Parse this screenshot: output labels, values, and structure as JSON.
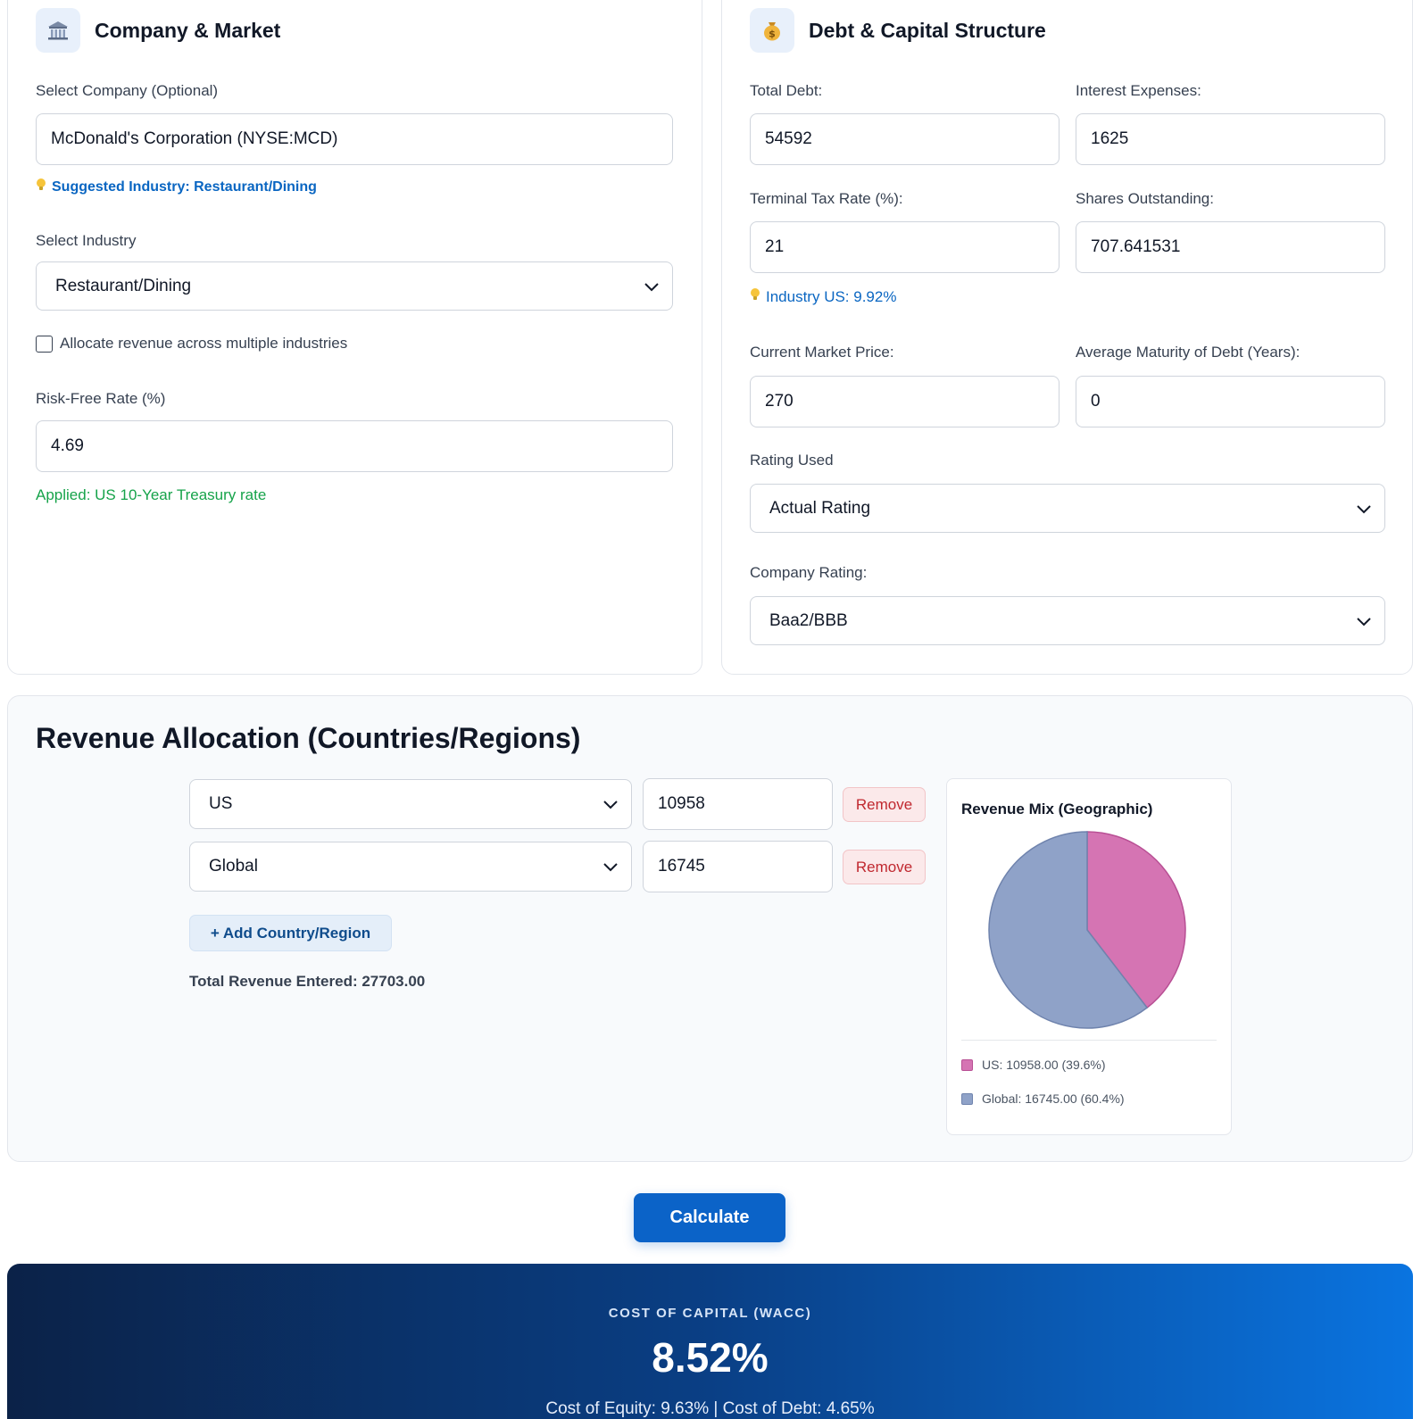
{
  "company_market": {
    "title": "Company & Market",
    "icon": "bank-building-icon",
    "company_label": "Select Company (Optional)",
    "company_value": "McDonald's Corporation (NYSE:MCD)",
    "suggested_industry": "Suggested Industry: Restaurant/Dining",
    "industry_label": "Select Industry",
    "industry_value": "Restaurant/Dining",
    "allocate_label": "Allocate revenue across multiple industries",
    "risk_free_label": "Risk-Free Rate (%)",
    "risk_free_value": "4.69",
    "applied_note": "Applied: US 10-Year Treasury rate"
  },
  "debt_capital": {
    "title": "Debt & Capital Structure",
    "icon": "money-bag-icon",
    "total_debt_label": "Total Debt:",
    "total_debt_value": "54592",
    "interest_label": "Interest Expenses:",
    "interest_value": "1625",
    "tax_label": "Terminal Tax Rate (%):",
    "tax_value": "21",
    "shares_label": "Shares Outstanding:",
    "shares_value": "707.641531",
    "industry_hint": "Industry US: 9.92%",
    "price_label": "Current Market Price:",
    "price_value": "270",
    "maturity_label": "Average Maturity of Debt (Years):",
    "maturity_value": "0",
    "rating_used_label": "Rating Used",
    "rating_used_value": "Actual Rating",
    "company_rating_label": "Company Rating:",
    "company_rating_value": "Baa2/BBB"
  },
  "revenue": {
    "title": "Revenue Allocation (Countries/Regions)",
    "rows": [
      {
        "region": "US",
        "amount": "10958",
        "remove": "Remove"
      },
      {
        "region": "Global",
        "amount": "16745",
        "remove": "Remove"
      }
    ],
    "add_label": "+ Add Country/Region",
    "total_label": "Total Revenue Entered: 27703.00"
  },
  "chart_data": {
    "type": "pie",
    "title": "Revenue Mix (Geographic)",
    "categories": [
      "US",
      "Global"
    ],
    "values": [
      10958,
      16745
    ],
    "colors": [
      "#d574b3",
      "#8fa2c8"
    ],
    "legend": [
      "US: 10958.00 (39.6%)",
      "Global: 16745.00 (60.4%)"
    ],
    "legend_position": "bottom"
  },
  "actions": {
    "calculate_label": "Calculate"
  },
  "result": {
    "label": "COST OF CAPITAL (WACC)",
    "value": "8.52%",
    "sub": "Cost of Equity: 9.63% | Cost of Debt: 4.65%"
  },
  "colors": {
    "accent": "#0b63c8",
    "hint_blue": "#0a66c2",
    "success_green": "#16a34a",
    "remove_red": "#c0282f"
  }
}
